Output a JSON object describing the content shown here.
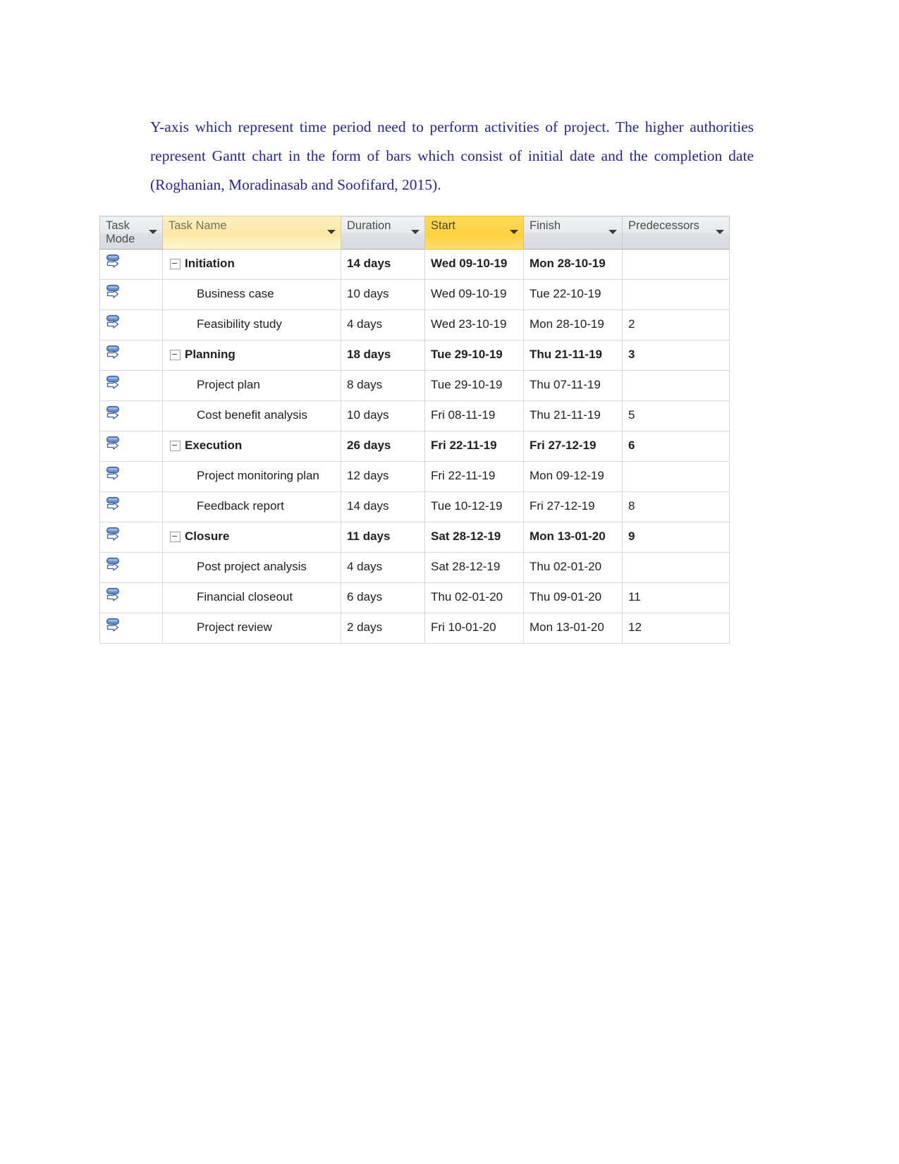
{
  "document": {
    "paragraph": "Y-axis which represent time period need to perform activities of project. The higher authorities represent Gantt chart in the form of bars which consist of initial date and the completion date (Roghanian,  Moradinasab and Soofifard, 2015).",
    "text_color": "#262699"
  },
  "table": {
    "columns": [
      {
        "key": "mode",
        "label": "Task Mode",
        "style": "plain",
        "has_filter": true
      },
      {
        "key": "name",
        "label": "Task Name",
        "style": "accent-light",
        "has_filter": true
      },
      {
        "key": "dur",
        "label": "Duration",
        "style": "plain",
        "has_filter": true
      },
      {
        "key": "start",
        "label": "Start",
        "style": "accent-strong",
        "has_filter": true
      },
      {
        "key": "finish",
        "label": "Finish",
        "style": "plain",
        "has_filter": true
      },
      {
        "key": "pred",
        "label": "Predecessors",
        "style": "plain",
        "has_filter": true
      }
    ],
    "accent_light_color": "#fce9a8",
    "accent_strong_color": "#ffd23f",
    "task_mode_icon": "auto-scheduled-icon",
    "rows": [
      {
        "level": 0,
        "summary": true,
        "name": "Initiation",
        "duration": "14 days",
        "start": "Wed 09-10-19",
        "finish": "Mon 28-10-19",
        "predecessors": ""
      },
      {
        "level": 1,
        "summary": false,
        "name": "Business case",
        "duration": "10 days",
        "start": "Wed 09-10-19",
        "finish": "Tue 22-10-19",
        "predecessors": ""
      },
      {
        "level": 1,
        "summary": false,
        "name": "Feasibility study",
        "duration": "4 days",
        "start": "Wed 23-10-19",
        "finish": "Mon 28-10-19",
        "predecessors": "2"
      },
      {
        "level": 0,
        "summary": true,
        "name": "Planning",
        "duration": "18 days",
        "start": "Tue 29-10-19",
        "finish": "Thu 21-11-19",
        "predecessors": "3"
      },
      {
        "level": 1,
        "summary": false,
        "name": "Project plan",
        "duration": "8 days",
        "start": "Tue 29-10-19",
        "finish": "Thu 07-11-19",
        "predecessors": ""
      },
      {
        "level": 1,
        "summary": false,
        "name": "Cost benefit analysis",
        "duration": "10 days",
        "start": "Fri 08-11-19",
        "finish": "Thu 21-11-19",
        "predecessors": "5"
      },
      {
        "level": 0,
        "summary": true,
        "name": "Execution",
        "duration": "26 days",
        "start": "Fri 22-11-19",
        "finish": "Fri 27-12-19",
        "predecessors": "6"
      },
      {
        "level": 1,
        "summary": false,
        "name": "Project monitoring plan",
        "duration": "12 days",
        "start": "Fri 22-11-19",
        "finish": "Mon 09-12-19",
        "predecessors": ""
      },
      {
        "level": 1,
        "summary": false,
        "name": "Feedback report",
        "duration": "14 days",
        "start": "Tue 10-12-19",
        "finish": "Fri 27-12-19",
        "predecessors": "8"
      },
      {
        "level": 0,
        "summary": true,
        "name": "Closure",
        "duration": "11 days",
        "start": "Sat 28-12-19",
        "finish": "Mon 13-01-20",
        "predecessors": "9"
      },
      {
        "level": 1,
        "summary": false,
        "name": "Post project analysis",
        "duration": "4 days",
        "start": "Sat 28-12-19",
        "finish": "Thu 02-01-20",
        "predecessors": ""
      },
      {
        "level": 1,
        "summary": false,
        "name": "Financial closeout",
        "duration": "6 days",
        "start": "Thu 02-01-20",
        "finish": "Thu 09-01-20",
        "predecessors": "11"
      },
      {
        "level": 1,
        "summary": false,
        "name": "Project review",
        "duration": "2 days",
        "start": "Fri 10-01-20",
        "finish": "Mon 13-01-20",
        "predecessors": "12"
      }
    ]
  }
}
